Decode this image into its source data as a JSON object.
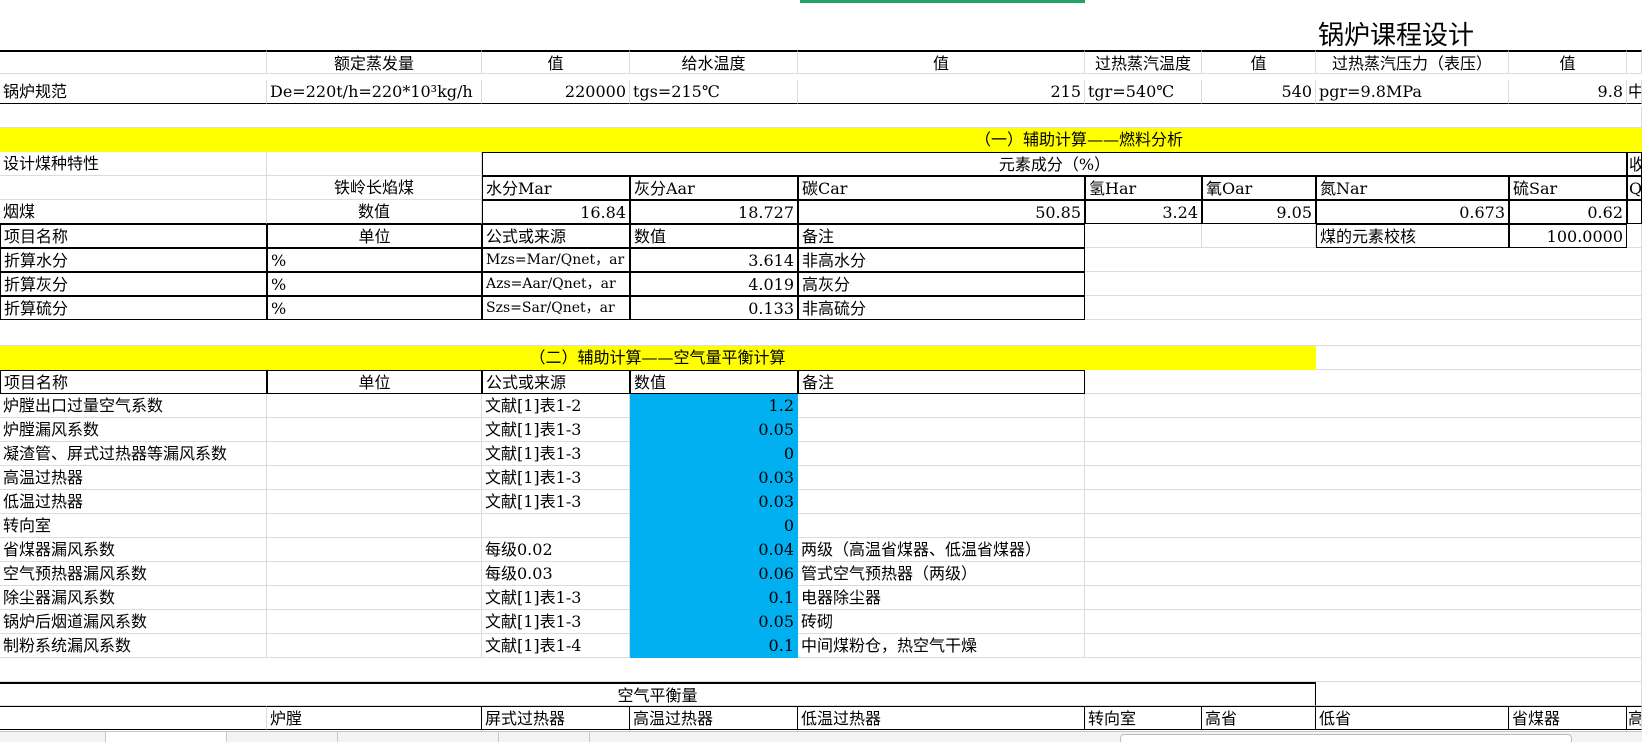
{
  "title": "锅炉课程设计",
  "spec": {
    "h_evap": "额定蒸发量",
    "h_val1": "值",
    "h_feedtemp": "给水温度",
    "h_val2": "值",
    "h_steamtemp": "过热蒸汽温度",
    "h_val3": "值",
    "h_steampress": "过热蒸汽压力（表压）",
    "h_val4": "值",
    "label": "锅炉规范",
    "evap_formula": "De=220t/h=220*10³kg/h",
    "evap_val": "220000",
    "feed_formula": "tgs=215℃",
    "feed_val": "215",
    "steam_formula": "tgr=540℃",
    "steam_val": "540",
    "press_formula": "pgr=9.8MPa",
    "press_val": "9.8",
    "overflow": "中"
  },
  "section1": {
    "header": "（一）辅助计算——燃料分析",
    "coal_char": "设计煤种特性",
    "element_comp": "元素成分（%）",
    "overflow_top": "收",
    "coal_name": "铁岭长焰煤",
    "cols": [
      "水分Mar",
      "灰分Aar",
      "碳Car",
      "氢Har",
      "氧Oar",
      "氮Nar",
      "硫Sar",
      "Qn"
    ],
    "coal_type": "烟煤",
    "value_label": "数值",
    "values": [
      "16.84",
      "18.727",
      "50.85",
      "3.24",
      "9.05",
      "0.673",
      "0.62"
    ],
    "table_head": {
      "name": "项目名称",
      "unit": "单位",
      "formula": "公式或来源",
      "value": "数值",
      "note": "备注"
    },
    "check_label": "煤的元素校核",
    "check_value": "100.0000",
    "rows": [
      {
        "name": "折算水分",
        "unit": "%",
        "formula": "Mzs=Mar/Qnet，ar",
        "value": "3.614",
        "note": "非高水分"
      },
      {
        "name": "折算灰分",
        "unit": "%",
        "formula": "Azs=Aar/Qnet，ar",
        "value": "4.019",
        "note": "高灰分"
      },
      {
        "name": "折算硫分",
        "unit": "%",
        "formula": "Szs=Sar/Qnet，ar",
        "value": "0.133",
        "note": "非高硫分"
      }
    ]
  },
  "section2": {
    "header": "（二）辅助计算——空气量平衡计算",
    "table_head": {
      "name": "项目名称",
      "unit": "单位",
      "formula": "公式或来源",
      "value": "数值",
      "note": "备注"
    },
    "rows": [
      {
        "name": "炉膛出口过量空气系数",
        "formula": "文献[1]表1-2",
        "value": "1.2",
        "note": ""
      },
      {
        "name": "炉膛漏风系数",
        "formula": "文献[1]表1-3",
        "value": "0.05",
        "note": ""
      },
      {
        "name": "凝渣管、屏式过热器等漏风系数",
        "formula": "文献[1]表1-3",
        "value": "0",
        "note": ""
      },
      {
        "name": "高温过热器",
        "formula": "文献[1]表1-3",
        "value": "0.03",
        "note": ""
      },
      {
        "name": "低温过热器",
        "formula": "文献[1]表1-3",
        "value": "0.03",
        "note": ""
      },
      {
        "name": "转向室",
        "formula": "",
        "value": "0",
        "note": ""
      },
      {
        "name": "省煤器漏风系数",
        "formula": "每级0.02",
        "value": "0.04",
        "note": "两级（高温省煤器、低温省煤器）"
      },
      {
        "name": "空气预热器漏风系数",
        "formula": "每级0.03",
        "value": "0.06",
        "note": "管式空气预热器（两级）"
      },
      {
        "name": "除尘器漏风系数",
        "formula": "文献[1]表1-3",
        "value": "0.1",
        "note": "电器除尘器"
      },
      {
        "name": "锅炉后烟道漏风系数",
        "formula": "文献[1]表1-3",
        "value": "0.05",
        "note": "砖砌"
      },
      {
        "name": "制粉系统漏风系数",
        "formula": "文献[1]表1-4",
        "value": "0.1",
        "note": "中间煤粉仓，热空气干燥"
      }
    ]
  },
  "balance": {
    "header": "空气平衡量",
    "cols": [
      "炉膛",
      "屏式过热器",
      "高温过热器",
      "低温过热器",
      "转向室",
      "高省",
      "低省",
      "省煤器",
      "高"
    ]
  },
  "tabs": [
    "",
    "",
    "",
    "",
    "",
    ""
  ]
}
